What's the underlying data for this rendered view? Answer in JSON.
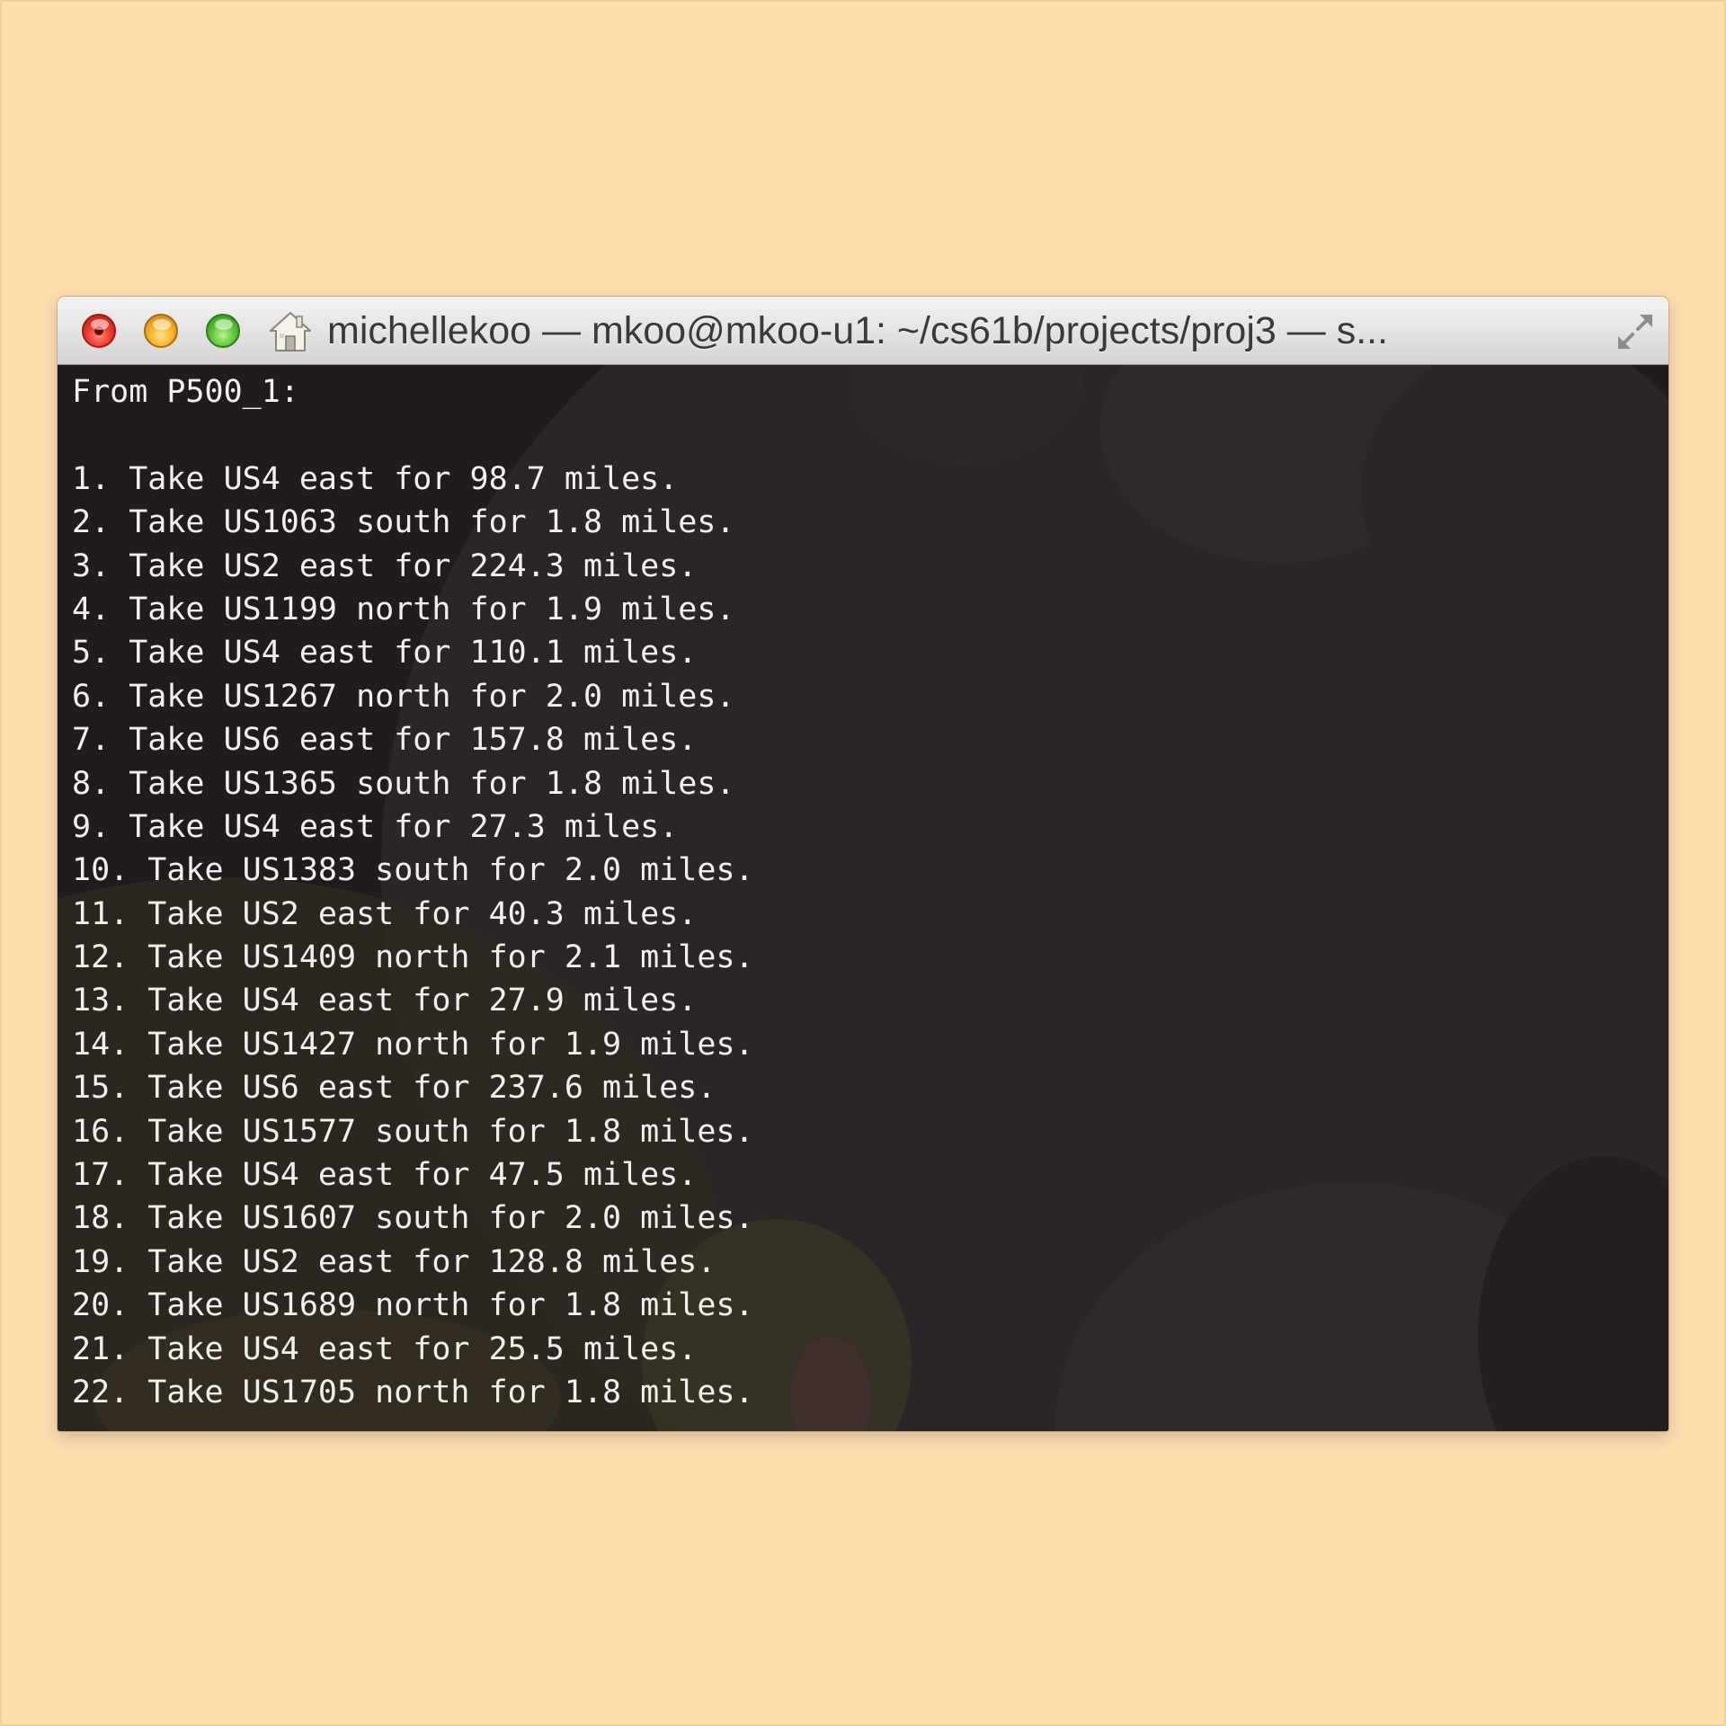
{
  "window": {
    "title": "michellekoo — mkoo@mkoo-u1: ~/cs61b/projects/proj3 — s..."
  },
  "terminal": {
    "lines": [
      "From P500_1:",
      "",
      "1. Take US4 east for 98.7 miles.",
      "2. Take US1063 south for 1.8 miles.",
      "3. Take US2 east for 224.3 miles.",
      "4. Take US1199 north for 1.9 miles.",
      "5. Take US4 east for 110.1 miles.",
      "6. Take US1267 north for 2.0 miles.",
      "7. Take US6 east for 157.8 miles.",
      "8. Take US1365 south for 1.8 miles.",
      "9. Take US4 east for 27.3 miles.",
      "10. Take US1383 south for 2.0 miles.",
      "11. Take US2 east for 40.3 miles.",
      "12. Take US1409 north for 2.1 miles.",
      "13. Take US4 east for 27.9 miles.",
      "14. Take US1427 north for 1.9 miles.",
      "15. Take US6 east for 237.6 miles.",
      "16. Take US1577 south for 1.8 miles.",
      "17. Take US4 east for 47.5 miles.",
      "18. Take US1607 south for 2.0 miles.",
      "19. Take US2 east for 128.8 miles.",
      "20. Take US1689 north for 1.8 miles.",
      "21. Take US4 east for 25.5 miles.",
      "22. Take US1705 north for 1.8 miles."
    ]
  },
  "icons": {
    "close": "close-button",
    "minimize": "minimize-button",
    "zoom": "zoom-button",
    "proxy": "home-icon",
    "fullscreen": "fullscreen-arrows-icon"
  },
  "colors": {
    "page_background": "#FEDDAF",
    "terminal_background": "#201A1C",
    "terminal_text": "#F2F0EC",
    "title_text": "#3A3A3A"
  }
}
